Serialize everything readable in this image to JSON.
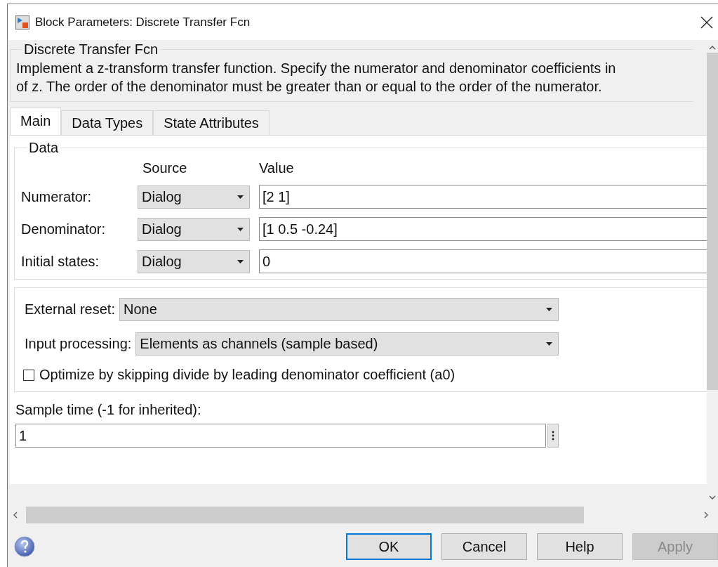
{
  "window": {
    "title": "Block Parameters: Discrete Transfer Fcn"
  },
  "block": {
    "title": "Discrete Transfer Fcn",
    "description_lines": [
      "Implement a z-transform transfer function. Specify the numerator and denominator coefficients in",
      "of z. The order of the denominator must be greater than or equal to the order of the numerator."
    ]
  },
  "tabs": [
    {
      "label": "Main",
      "selected": true
    },
    {
      "label": "Data Types",
      "selected": false
    },
    {
      "label": "State Attributes",
      "selected": false
    }
  ],
  "data_group": {
    "title": "Data",
    "columns": [
      "Source",
      "Value"
    ],
    "rows": [
      {
        "label": "Numerator:",
        "source": "Dialog",
        "value": "[2 1]"
      },
      {
        "label": "Denominator:",
        "source": "Dialog",
        "value": "[1 0.5 -0.24]"
      },
      {
        "label": "Initial states:",
        "source": "Dialog",
        "value": "0"
      }
    ]
  },
  "options": [
    {
      "kind": "dropdown",
      "label": "External reset:",
      "value": "None"
    },
    {
      "kind": "dropdown",
      "label": "Input processing:",
      "value": "Elements as channels (sample based)"
    },
    {
      "kind": "checkbox",
      "label": "Optimize by skipping divide by leading denominator coefficient (a0)",
      "checked": false
    }
  ],
  "sample_time": {
    "label": "Sample time (-1 for inherited):",
    "value": "1"
  },
  "buttons": [
    {
      "label": "OK",
      "default": true,
      "disabled": false
    },
    {
      "label": "Cancel",
      "default": false,
      "disabled": false
    },
    {
      "label": "Help",
      "default": false,
      "disabled": false
    },
    {
      "label": "Apply",
      "default": false,
      "disabled": true
    }
  ]
}
